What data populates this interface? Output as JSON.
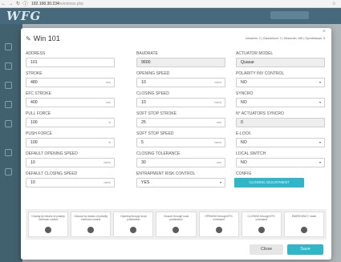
{
  "browser": {
    "back_icon": "back-arrow-icon",
    "url_host": "192.168.30.234",
    "url_path": "/windows.php"
  },
  "app": {
    "logo": "WFG"
  },
  "modal": {
    "title": "Win 101",
    "summary": "Imbanhis: 2 | Glassbloom: 3 | Sbianchin: 480 | Sponfinissan: 5",
    "fields": {
      "address": {
        "label": "ADDRESS",
        "value": "101"
      },
      "baudrate": {
        "label": "BAUDRATE",
        "value": "9600"
      },
      "actuator_model": {
        "label": "ACTUATOR MODEL",
        "value": "Quasar"
      },
      "stroke": {
        "label": "STROKE",
        "value": "480",
        "unit": "mm"
      },
      "opening_speed": {
        "label": "OPENING SPEED",
        "value": "10",
        "unit": "mm/s"
      },
      "polarity_inv_control": {
        "label": "POLARITY INV CONTROL",
        "value": "NO"
      },
      "efc_stroke": {
        "label": "EFC STROKE",
        "value": "400",
        "unit": "mm"
      },
      "closing_speed": {
        "label": "CLOSING SPEED",
        "value": "10",
        "unit": "mm/s"
      },
      "syncro": {
        "label": "SYNCRO",
        "value": "NO"
      },
      "pull_force": {
        "label": "PULL FORCE",
        "value": "100",
        "unit": "N"
      },
      "soft_stop_stroke": {
        "label": "SOFT STOP STROKE",
        "value": "25",
        "unit": "mm"
      },
      "n_actuators_syncro": {
        "label": "N° ACTUATORS SYNCRO",
        "value": "0"
      },
      "push_force": {
        "label": "PUSH FORCE",
        "value": "100",
        "unit": "N"
      },
      "soft_stop_speed": {
        "label": "SOFT STOP SPEED",
        "value": "5",
        "unit": "mm/s"
      },
      "e_lock": {
        "label": "E-LOCK",
        "value": "NO"
      },
      "default_opening_speed": {
        "label": "DEFAULT OPENING SPEED",
        "value": "10",
        "unit": "mm/s"
      },
      "closing_tolerance": {
        "label": "CLOSING TOLERANCE",
        "value": "30",
        "unit": "mm"
      },
      "local_switch": {
        "label": "LOCAL SWITCH",
        "value": "NO"
      },
      "default_closing_speed": {
        "label": "DEFAULT CLOSING SPEED",
        "value": "10",
        "unit": "mm/s"
      },
      "entrapment_risk_control": {
        "label": "ENTRAPMENT RISK CONTROL",
        "value": "YES"
      }
    },
    "config": {
      "label": "CONFIG",
      "button_label": "CLOSING ADJUSTMENT"
    },
    "status_cards": [
      {
        "label": "Closing by means of polarity inversion control"
      },
      {
        "label": "Closure by means of polarity inversion control"
      },
      {
        "label": "Opening through local pushbutton"
      },
      {
        "label": "Closure through local pushbutton"
      },
      {
        "label": "OPENING through EFC command"
      },
      {
        "label": "CLOSING through EFC command"
      },
      {
        "label": "EMERGENCY mode"
      }
    ],
    "footer": {
      "close_label": "Close",
      "save_label": "Save"
    }
  }
}
